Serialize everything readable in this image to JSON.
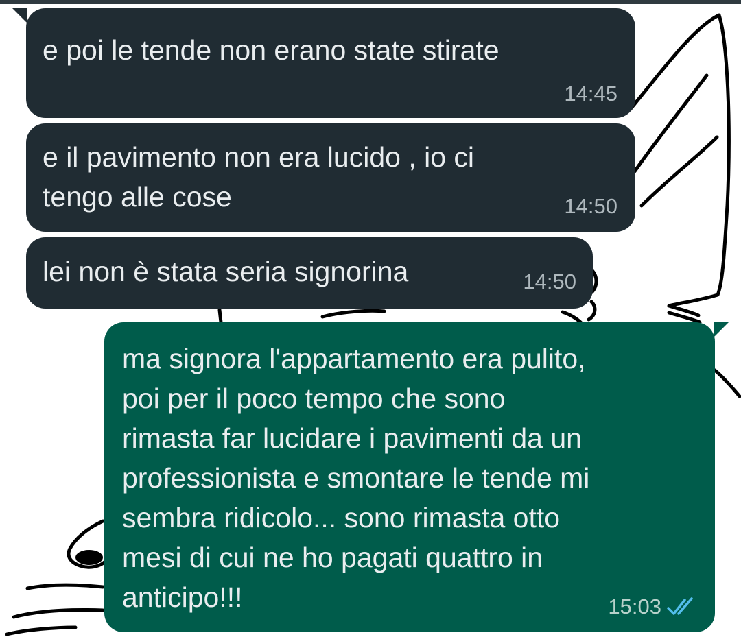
{
  "conversation": {
    "messages": [
      {
        "text": "e poi le tende non erano state stirate",
        "time": "14:45"
      },
      {
        "text": "e il pavimento non era lucido , io ci\ntengo alle cose",
        "time": "14:50"
      },
      {
        "text": "lei non è stata seria signorina",
        "time": "14:50"
      },
      {
        "text": "ma signora l'appartamento era pulito,\npoi per il poco tempo che sono\nrimasta far lucidare i pavimenti da un\nprofessionista e smontare le tende mi\nsembra ridicolo... sono rimasta otto\nmesi di cui ne ho pagati quattro in\nanticipo!!!",
        "time": "15:03",
        "status_icon": "double-check-read-icon"
      }
    ]
  },
  "colors": {
    "incoming_bubble": "#202c33",
    "outgoing_bubble": "#005c4b",
    "read_ticks": "#53bdeb"
  }
}
